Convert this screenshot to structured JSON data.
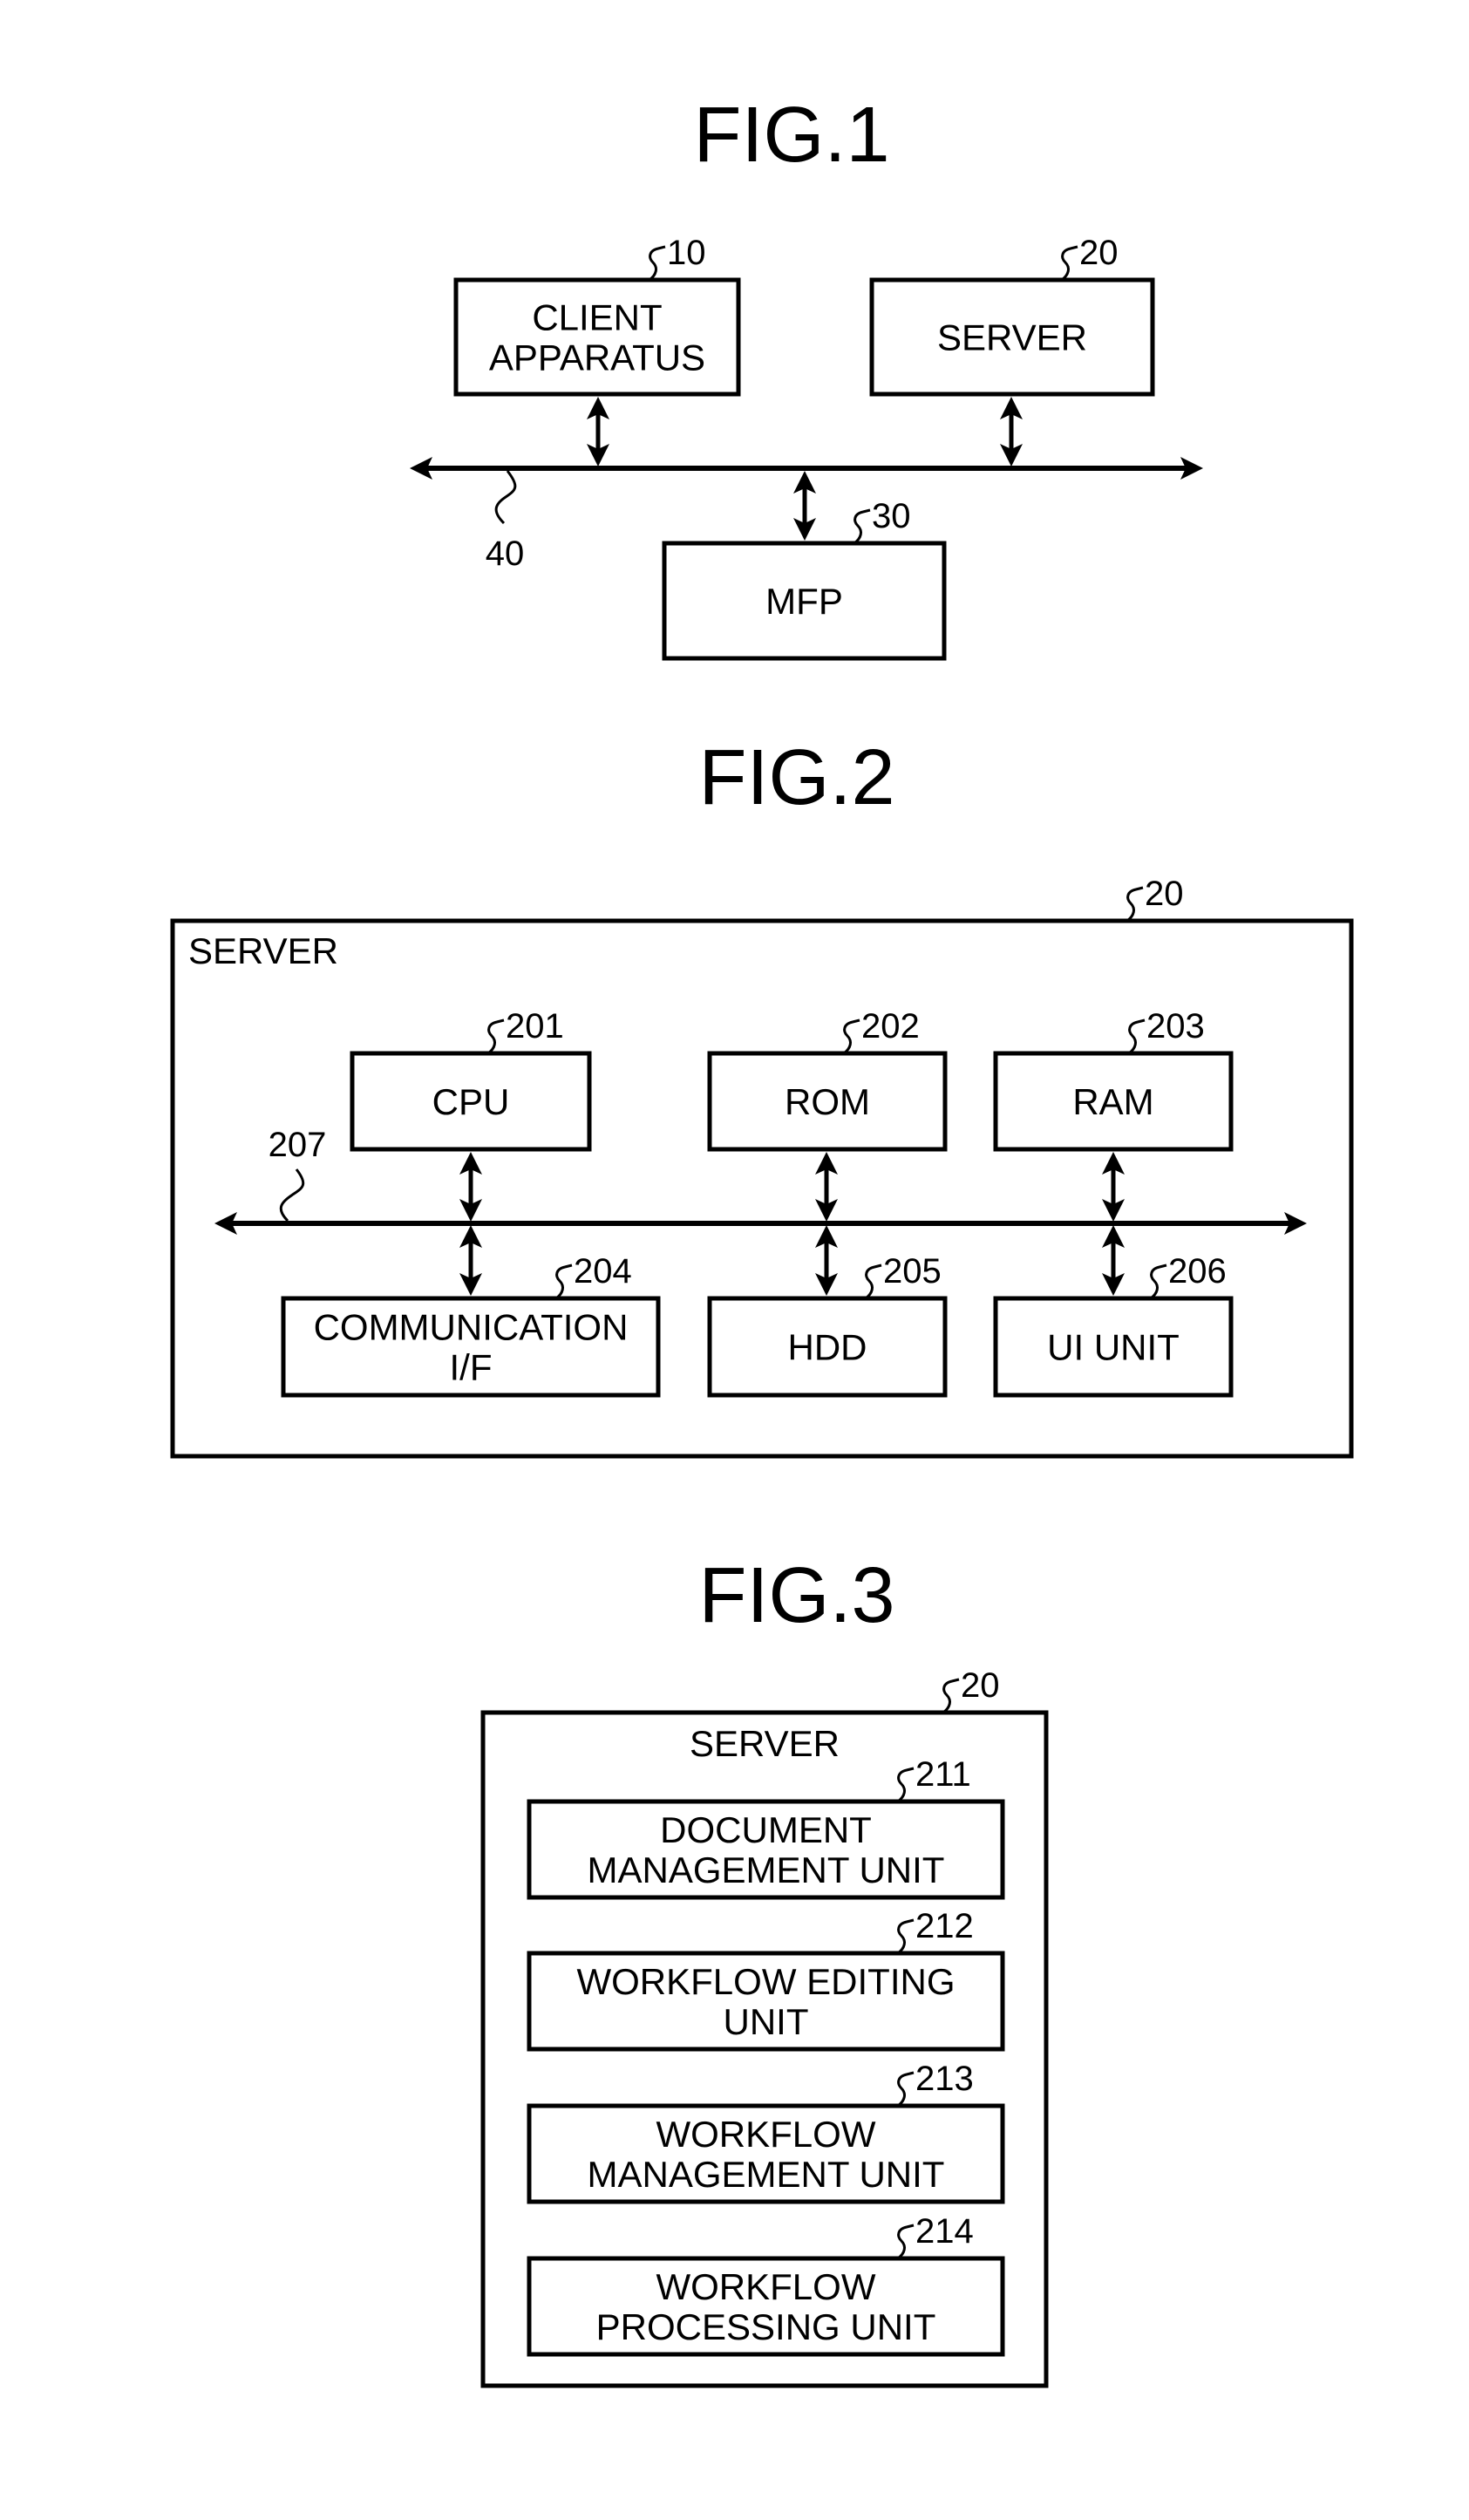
{
  "colors": {
    "ink": "#000000",
    "paper": "#ffffff"
  },
  "fig1": {
    "title": "FIG.1",
    "client": {
      "lines": [
        "CLIENT",
        "APPARATUS"
      ],
      "ref": "10"
    },
    "server": {
      "lines": [
        "SERVER"
      ],
      "ref": "20"
    },
    "mfp": {
      "lines": [
        "MFP"
      ],
      "ref": "30"
    },
    "network": {
      "ref": "40"
    }
  },
  "fig2": {
    "title": "FIG.2",
    "container": {
      "label": "SERVER",
      "ref": "20"
    },
    "bus": {
      "ref": "207"
    },
    "units": [
      {
        "id": "cpu",
        "lines": [
          "CPU"
        ],
        "ref": "201"
      },
      {
        "id": "rom",
        "lines": [
          "ROM"
        ],
        "ref": "202"
      },
      {
        "id": "ram",
        "lines": [
          "RAM"
        ],
        "ref": "203"
      },
      {
        "id": "comm",
        "lines": [
          "COMMUNICATION",
          "I/F"
        ],
        "ref": "204"
      },
      {
        "id": "hdd",
        "lines": [
          "HDD"
        ],
        "ref": "205"
      },
      {
        "id": "ui",
        "lines": [
          "UI UNIT"
        ],
        "ref": "206"
      }
    ]
  },
  "fig3": {
    "title": "FIG.3",
    "container": {
      "label": "SERVER",
      "ref": "20"
    },
    "units": [
      {
        "id": "doc-mgmt",
        "lines": [
          "DOCUMENT",
          "MANAGEMENT UNIT"
        ],
        "ref": "211"
      },
      {
        "id": "wf-edit",
        "lines": [
          "WORKFLOW EDITING",
          "UNIT"
        ],
        "ref": "212"
      },
      {
        "id": "wf-mgmt",
        "lines": [
          "WORKFLOW",
          "MANAGEMENT UNIT"
        ],
        "ref": "213"
      },
      {
        "id": "wf-proc",
        "lines": [
          "WORKFLOW",
          "PROCESSING UNIT"
        ],
        "ref": "214"
      }
    ]
  }
}
